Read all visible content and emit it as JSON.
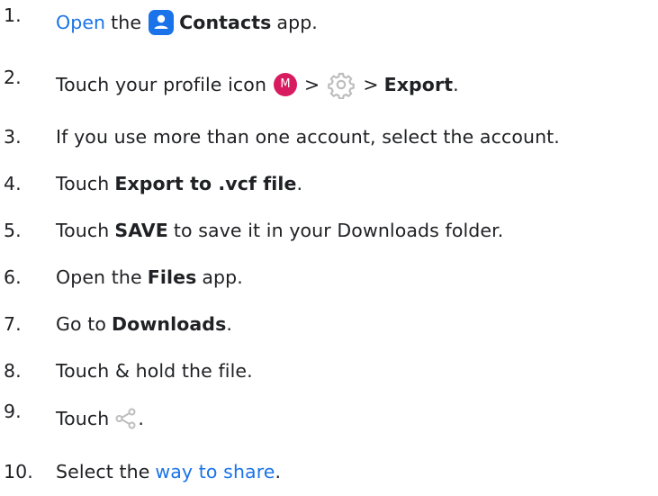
{
  "steps": [
    {
      "number": "1.",
      "open_link": "Open",
      "the": "the",
      "app_name": "Contacts",
      "app_suffix": "app."
    },
    {
      "number": "2.",
      "text": "Touch your profile icon",
      "avatar_letter": "M",
      "sep1": ">",
      "sep2": ">",
      "action": "Export",
      "period": "."
    },
    {
      "number": "3.",
      "text": "If you use more than one account, select the account."
    },
    {
      "number": "4.",
      "prefix": "Touch",
      "action": "Export to .vcf file",
      "period": "."
    },
    {
      "number": "5.",
      "prefix": "Touch",
      "action": "SAVE",
      "suffix": "to save it in your Downloads folder."
    },
    {
      "number": "6.",
      "prefix": "Open the",
      "app_name": "Files",
      "suffix": "app."
    },
    {
      "number": "7.",
      "prefix": "Go to",
      "target": "Downloads",
      "period": "."
    },
    {
      "number": "8.",
      "text": "Touch & hold the file."
    },
    {
      "number": "9.",
      "prefix": "Touch",
      "period": "."
    },
    {
      "number": "10.",
      "prefix": "Select the",
      "link": "way to share",
      "period": "."
    }
  ],
  "icons": {
    "contacts": "contacts-app-icon",
    "avatar": "profile-avatar-icon",
    "settings": "gear-icon",
    "share": "share-icon"
  },
  "colors": {
    "link": "#1a73e8",
    "contacts_icon": "#1a73e8",
    "avatar": "#d81b60",
    "gear": "#bdbdbd",
    "share": "#bdbdbd"
  }
}
